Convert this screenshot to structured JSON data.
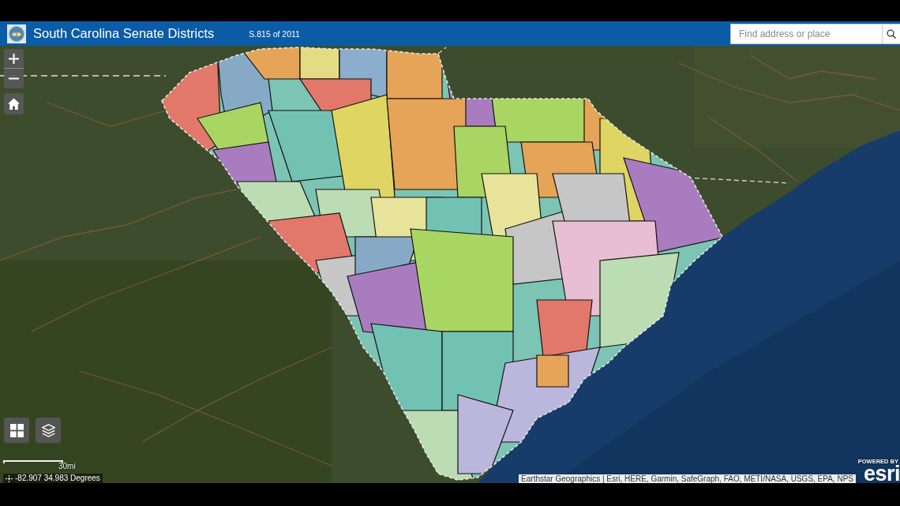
{
  "header": {
    "title": "South Carolina Senate Districts",
    "subtitle": "S.815 of 2011",
    "search": {
      "placeholder": "Find address or place"
    }
  },
  "map": {
    "scale_bar": {
      "label": "30mi"
    },
    "coordinates": "-82.907 34.983 Degrees",
    "attribution": "Earthstar Geographics | Esri, HERE, Garmin, SafeGraph, FAO, METI/NASA, USGS, EPA, NPS",
    "logo": {
      "tagline": "POWERED BY",
      "wordmark": "esri"
    }
  }
}
